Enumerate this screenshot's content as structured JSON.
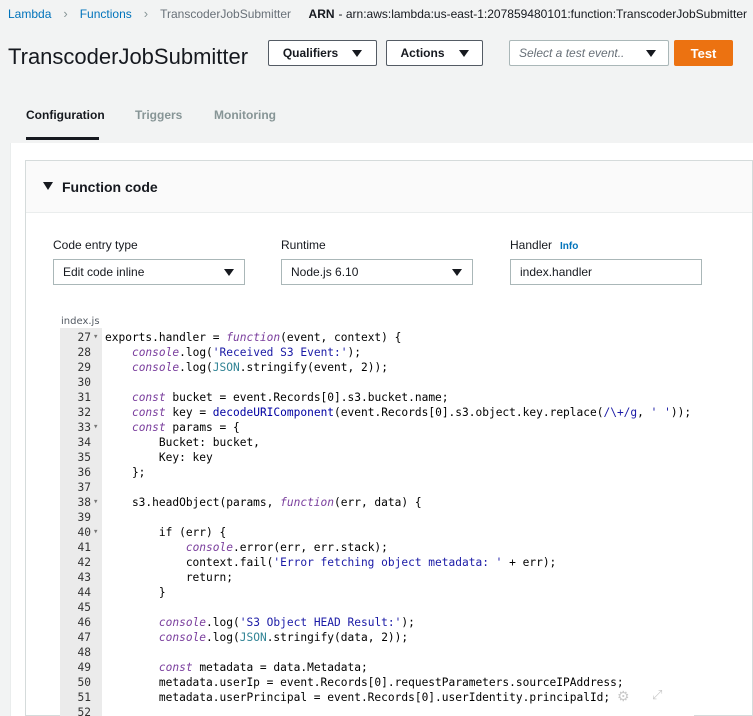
{
  "breadcrumb": {
    "items": [
      "Lambda",
      "Functions"
    ],
    "current": "TranscoderJobSubmitter"
  },
  "arn": {
    "label": "ARN",
    "value": "- arn:aws:lambda:us-east-1:207859480101:function:TranscoderJobSubmitter"
  },
  "page_title": "TranscoderJobSubmitter",
  "toolbar": {
    "qualifiers_label": "Qualifiers",
    "actions_label": "Actions",
    "test_event_placeholder": "Select a test event..",
    "test_label": "Test"
  },
  "tabs": [
    {
      "label": "Configuration",
      "active": true
    },
    {
      "label": "Triggers",
      "active": false
    },
    {
      "label": "Monitoring",
      "active": false
    }
  ],
  "function_code": {
    "title": "Function code",
    "code_entry": {
      "label": "Code entry type",
      "value": "Edit code inline"
    },
    "runtime": {
      "label": "Runtime",
      "value": "Node.js 6.10"
    },
    "handler": {
      "label": "Handler",
      "info": "Info",
      "value": "index.handler"
    },
    "file_tab": "index.js",
    "lines": [
      {
        "n": "27",
        "fold": true,
        "text": "exports.handler = function(event, context) {"
      },
      {
        "n": "28",
        "fold": false,
        "text": "    console.log('Received S3 Event:');"
      },
      {
        "n": "29",
        "fold": false,
        "text": "    console.log(JSON.stringify(event, 2));"
      },
      {
        "n": "30",
        "fold": false,
        "text": ""
      },
      {
        "n": "31",
        "fold": false,
        "text": "    const bucket = event.Records[0].s3.bucket.name;"
      },
      {
        "n": "32",
        "fold": false,
        "text": "    const key = decodeURIComponent(event.Records[0].s3.object.key.replace(/\\+/g, ' '));"
      },
      {
        "n": "33",
        "fold": true,
        "text": "    const params = {"
      },
      {
        "n": "34",
        "fold": false,
        "text": "        Bucket: bucket,"
      },
      {
        "n": "35",
        "fold": false,
        "text": "        Key: key"
      },
      {
        "n": "36",
        "fold": false,
        "text": "    };"
      },
      {
        "n": "37",
        "fold": false,
        "text": ""
      },
      {
        "n": "38",
        "fold": true,
        "text": "    s3.headObject(params, function(err, data) {"
      },
      {
        "n": "39",
        "fold": false,
        "text": ""
      },
      {
        "n": "40",
        "fold": true,
        "text": "        if (err) {"
      },
      {
        "n": "41",
        "fold": false,
        "text": "            console.error(err, err.stack);"
      },
      {
        "n": "42",
        "fold": false,
        "text": "            context.fail('Error fetching object metadata: ' + err);"
      },
      {
        "n": "43",
        "fold": false,
        "text": "            return;"
      },
      {
        "n": "44",
        "fold": false,
        "text": "        }"
      },
      {
        "n": "45",
        "fold": false,
        "text": ""
      },
      {
        "n": "46",
        "fold": false,
        "text": "        console.log('S3 Object HEAD Result:');"
      },
      {
        "n": "47",
        "fold": false,
        "text": "        console.log(JSON.stringify(data, 2));"
      },
      {
        "n": "48",
        "fold": false,
        "text": ""
      },
      {
        "n": "49",
        "fold": false,
        "text": "        const metadata = data.Metadata;"
      },
      {
        "n": "50",
        "fold": false,
        "text": "        metadata.userIp = event.Records[0].requestParameters.sourceIPAddress;"
      },
      {
        "n": "51",
        "fold": false,
        "text": "        metadata.userPrincipal = event.Records[0].userIdentity.principalId;"
      },
      {
        "n": "52",
        "fold": false,
        "text": ""
      }
    ]
  },
  "icons": {
    "gear": "gear-icon",
    "expand": "expand-icon"
  },
  "colors": {
    "test_button": "#ec7211",
    "link": "#0073bb"
  }
}
